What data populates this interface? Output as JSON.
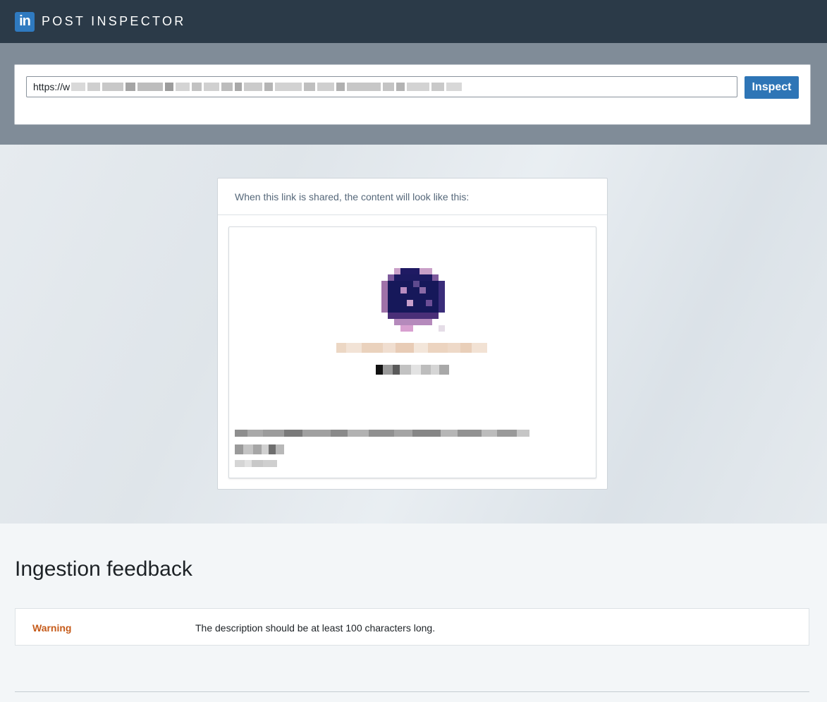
{
  "header": {
    "logo_text": "in",
    "title": "POST INSPECTOR",
    "brand_color": "#2f7ac0"
  },
  "url_form": {
    "url_value": "https://w",
    "inspect_label": "Inspect"
  },
  "preview": {
    "heading": "When this link is shared, the content will look like this:"
  },
  "feedback": {
    "title": "Ingestion feedback",
    "rows": [
      {
        "level": "Warning",
        "message": "The description should be at least 100 characters long.",
        "level_color": "#c65b1a"
      }
    ]
  }
}
